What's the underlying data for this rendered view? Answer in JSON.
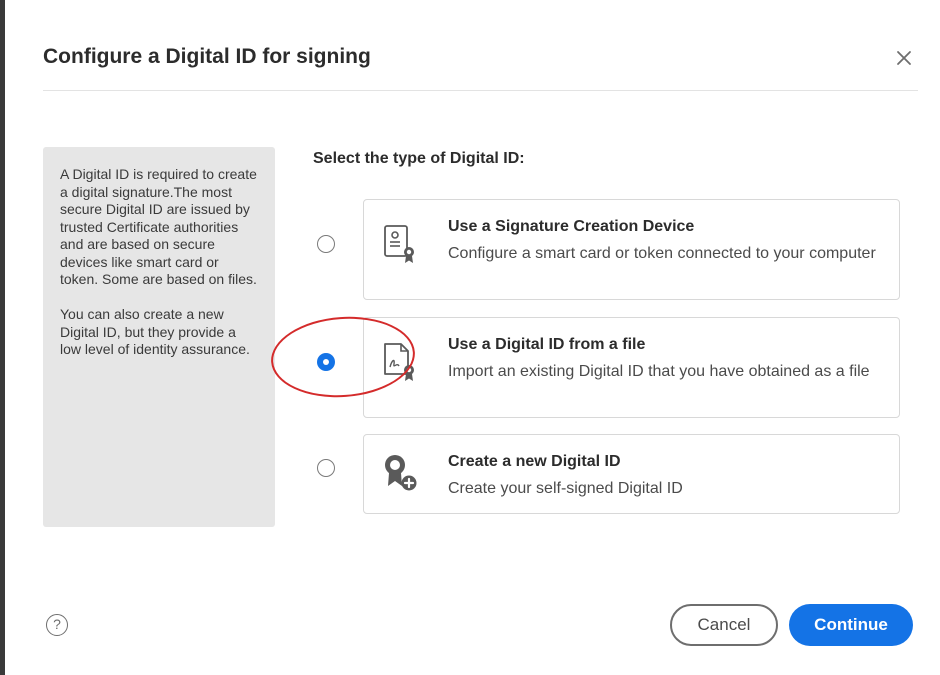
{
  "dialog": {
    "title": "Configure a Digital ID for signing",
    "close_icon": "close-icon"
  },
  "info": {
    "paragraph1": "A Digital ID is required to create a digital signature.The most secure Digital ID are issued by trusted Certificate authorities and are based on secure devices like smart card or token. Some are based on files.",
    "paragraph2": "You can also create a new Digital ID, but they provide a low level of identity assurance."
  },
  "section_label": "Select the type of Digital ID:",
  "options": [
    {
      "title": "Use a Signature Creation Device",
      "description": "Configure a smart card or token connected to your computer",
      "icon": "certificate-device-icon",
      "selected": false
    },
    {
      "title": "Use a Digital ID from a file",
      "description": "Import an existing Digital ID that you have obtained as a file",
      "icon": "certificate-file-icon",
      "selected": true
    },
    {
      "title": "Create a new Digital ID",
      "description": "Create your self-signed Digital ID",
      "icon": "new-digital-id-icon",
      "selected": false
    }
  ],
  "footer": {
    "help_icon": "help-icon",
    "help_glyph": "?",
    "cancel_label": "Cancel",
    "continue_label": "Continue"
  },
  "colors": {
    "accent": "#1473e6",
    "annotation": "#d42b2b",
    "panel_bg": "#e6e6e6"
  }
}
